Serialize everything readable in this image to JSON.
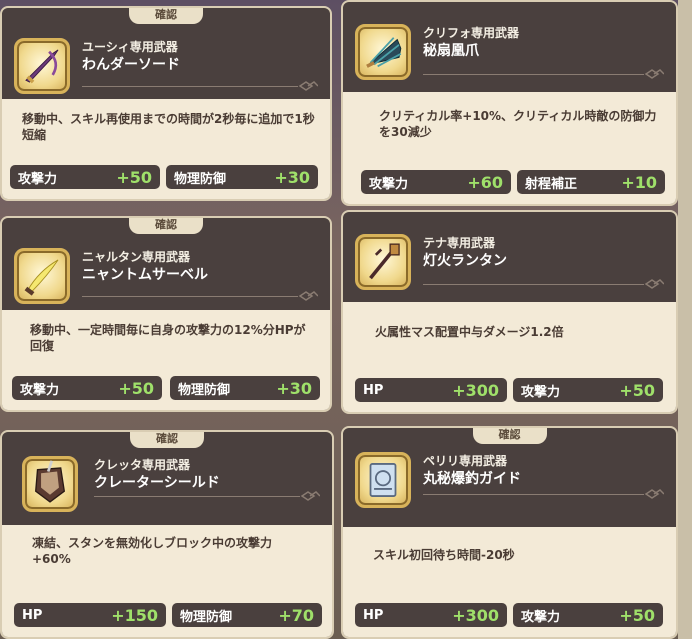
{
  "dialog_tab": "確認",
  "cards": [
    {
      "owner": "ユーシィ専用武器",
      "weapon": "わんダーソード",
      "icon": "sword-icon",
      "description": "移動中、スキル再使用までの時間が2秒毎に追加で1秒短縮",
      "stats": [
        {
          "label": "攻撃力",
          "value": "+50"
        },
        {
          "label": "物理防御",
          "value": "+30"
        }
      ]
    },
    {
      "owner": "クリフォ専用武器",
      "weapon": "秘扇凰爪",
      "icon": "fan-claw-icon",
      "description": "クリティカル率+10%、クリティカル時敵の防御力を30減少",
      "stats": [
        {
          "label": "攻撃力",
          "value": "+60"
        },
        {
          "label": "射程補正",
          "value": "+10"
        }
      ]
    },
    {
      "owner": "ニャルタン専用武器",
      "weapon": "ニャントムサーベル",
      "icon": "saber-icon",
      "description": "移動中、一定時間毎に自身の攻撃力の12%分HPが回復",
      "stats": [
        {
          "label": "攻撃力",
          "value": "+50"
        },
        {
          "label": "物理防御",
          "value": "+30"
        }
      ]
    },
    {
      "owner": "テナ専用武器",
      "weapon": "灯火ランタン",
      "icon": "lantern-staff-icon",
      "description": "火属性マス配置中与ダメージ1.2倍",
      "stats": [
        {
          "label": "HP",
          "value": "+300"
        },
        {
          "label": "攻撃力",
          "value": "+50"
        }
      ]
    },
    {
      "owner": "クレッタ専用武器",
      "weapon": "クレーターシールド",
      "icon": "shield-icon",
      "description": "凍結、スタンを無効化しブロック中の攻撃力+60%",
      "stats": [
        {
          "label": "HP",
          "value": "+150"
        },
        {
          "label": "物理防御",
          "value": "+70"
        }
      ]
    },
    {
      "owner": "ペリリ専用武器",
      "weapon": "丸秘爆釣ガイド",
      "icon": "guide-book-icon",
      "description": "スキル初回待ち時間-20秒",
      "stats": [
        {
          "label": "HP",
          "value": "+300"
        },
        {
          "label": "攻撃力",
          "value": "+50"
        }
      ]
    }
  ]
}
